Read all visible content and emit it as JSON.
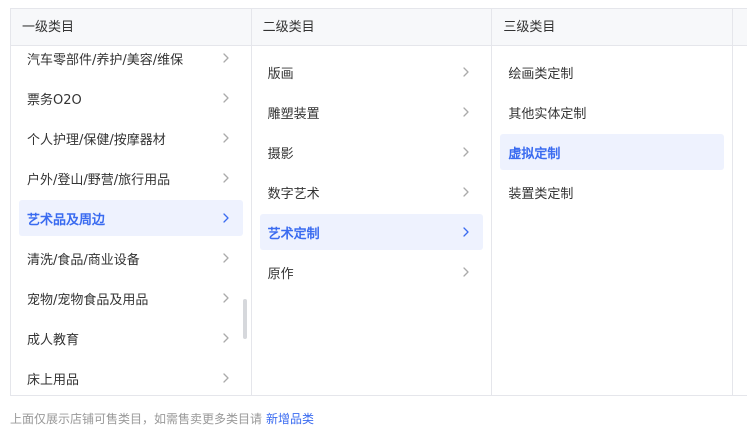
{
  "columns": [
    {
      "title": "一级类目",
      "items": [
        {
          "label": "汽车零部件/养护/美容/维保",
          "active": false
        },
        {
          "label": "票务O2O",
          "active": false
        },
        {
          "label": "个人护理/保健/按摩器材",
          "active": false
        },
        {
          "label": "户外/登山/野营/旅行用品",
          "active": false
        },
        {
          "label": "艺术品及周边",
          "active": true
        },
        {
          "label": "清洗/食品/商业设备",
          "active": false
        },
        {
          "label": "宠物/宠物食品及用品",
          "active": false
        },
        {
          "label": "成人教育",
          "active": false
        },
        {
          "label": "床上用品",
          "active": false
        }
      ]
    },
    {
      "title": "二级类目",
      "items": [
        {
          "label": "版画",
          "active": false
        },
        {
          "label": "雕塑装置",
          "active": false
        },
        {
          "label": "摄影",
          "active": false
        },
        {
          "label": "数字艺术",
          "active": false
        },
        {
          "label": "艺术定制",
          "active": true
        },
        {
          "label": "原作",
          "active": false
        }
      ]
    },
    {
      "title": "三级类目",
      "items": [
        {
          "label": "绘画类定制",
          "active": false
        },
        {
          "label": "其他实体定制",
          "active": false
        },
        {
          "label": "虚拟定制",
          "active": true
        },
        {
          "label": "装置类定制",
          "active": false
        }
      ]
    }
  ],
  "footer": {
    "text": "上面仅展示店铺可售类目，如需售卖更多类目请",
    "link": "新增品类"
  },
  "colors": {
    "accent": "#3a6bf0",
    "active_bg": "#eef2fe",
    "header_bg": "#f7f8fa",
    "border": "#e5e6eb"
  },
  "icons": {
    "expand": "chevron-right-icon"
  }
}
